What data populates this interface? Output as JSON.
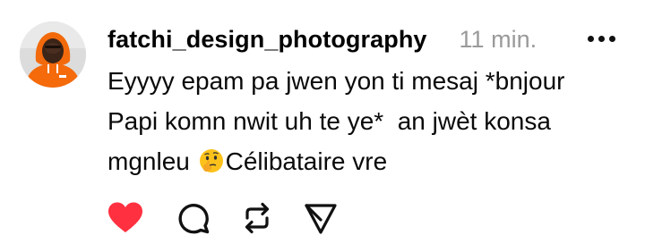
{
  "post": {
    "username": "fatchi_design_photography",
    "timestamp": "11 min.",
    "lines": [
      "Eyyyy epam pa jwen yon ti mesaj *bnjour",
      "Papi komn nwit uh te ye*  an jwèt konsa",
      "mgnleu",
      "Célibataire vre"
    ],
    "emoji": "thinking-face-icon"
  },
  "actions": {
    "like": {
      "icon": "heart-icon",
      "active": true,
      "color": "#ff3040"
    },
    "comment": {
      "icon": "comment-icon"
    },
    "repost": {
      "icon": "repost-icon"
    },
    "share": {
      "icon": "share-icon"
    }
  },
  "colors": {
    "avatar_hoodie": "#f56a0a",
    "timestamp": "#9a9a9a",
    "like": "#ff3040"
  }
}
